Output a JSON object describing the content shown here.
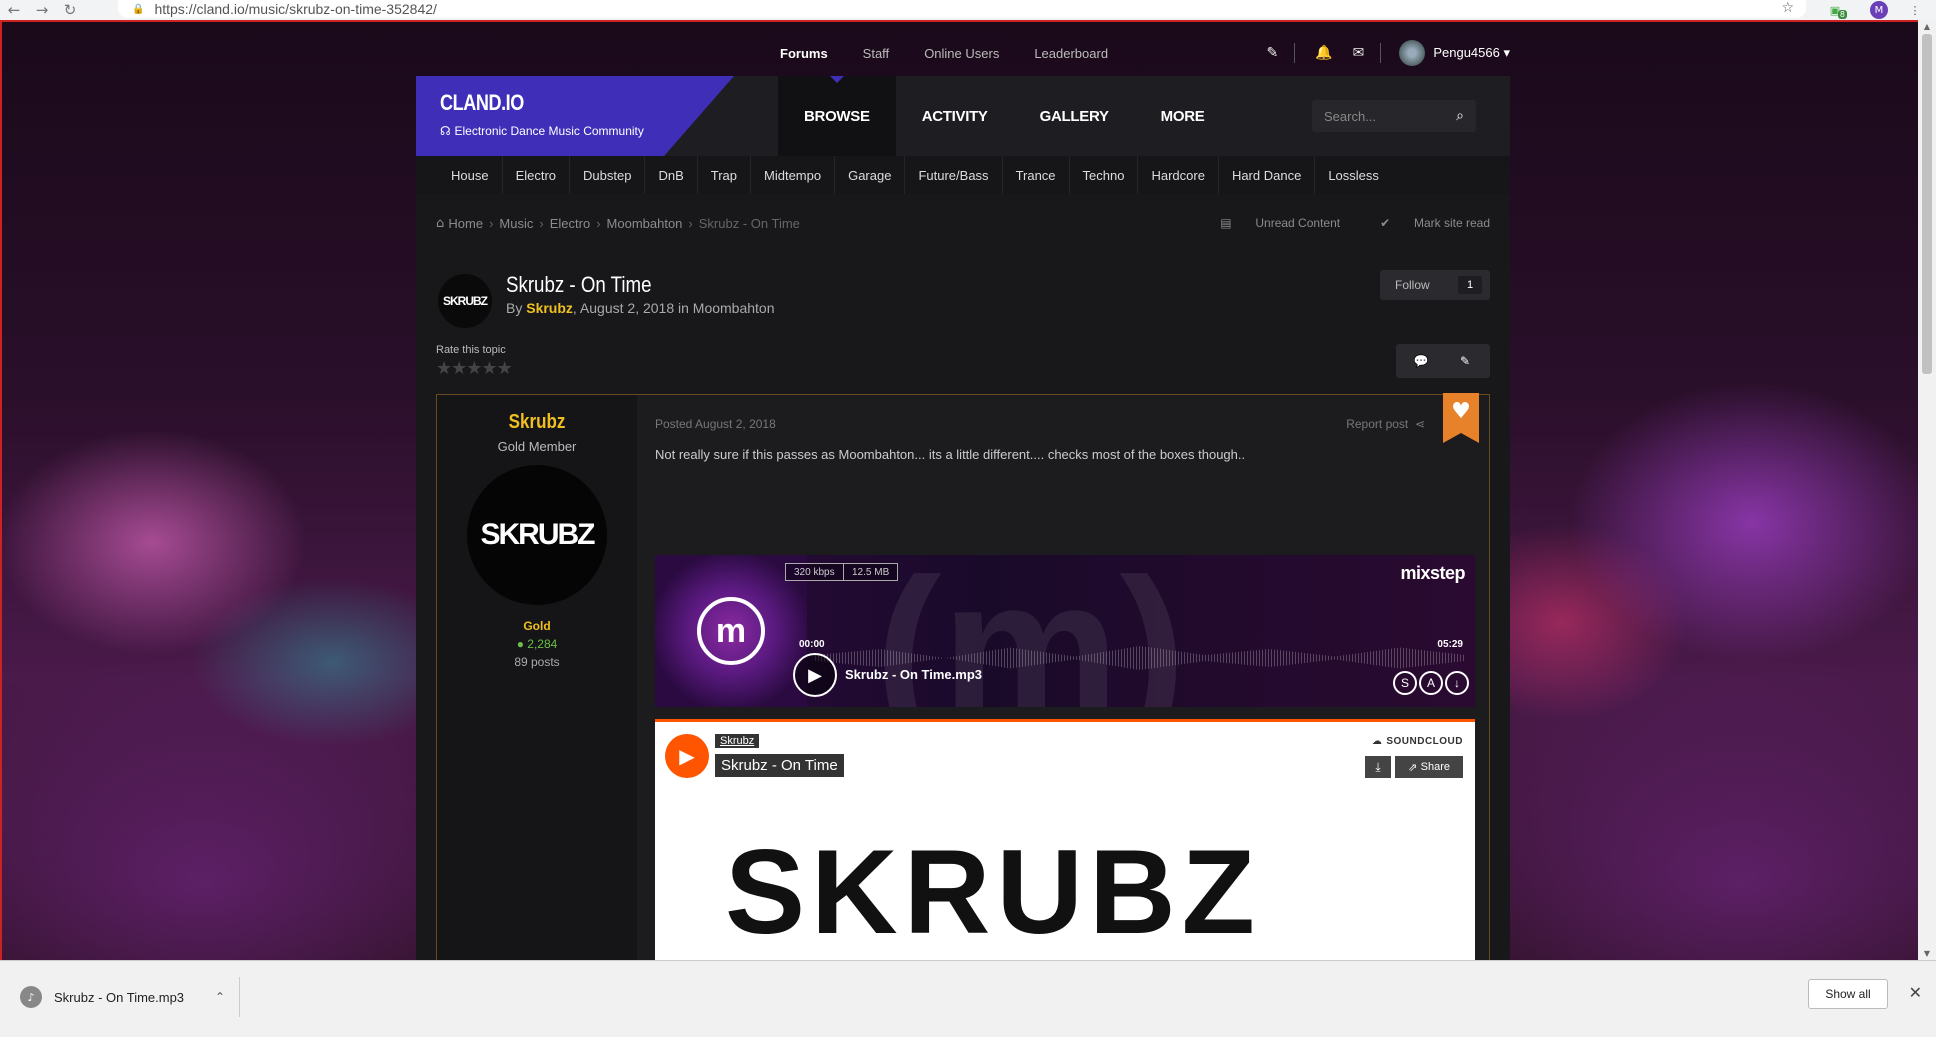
{
  "browser": {
    "url": "https://cland.io/music/skrubz-on-time-352842/",
    "ext_badge": "8",
    "profile_letter": "M"
  },
  "util_nav": {
    "items": [
      "Forums",
      "Staff",
      "Online Users",
      "Leaderboard"
    ],
    "username": "Pengu4566 ▾"
  },
  "brand": {
    "title": "CLAND.IO",
    "subtitle": "Electronic Dance Music Community"
  },
  "main_nav": [
    "BROWSE",
    "ACTIVITY",
    "GALLERY",
    "MORE"
  ],
  "search": {
    "placeholder": "Search..."
  },
  "sub_nav": [
    "House",
    "Electro",
    "Dubstep",
    "DnB",
    "Trap",
    "Midtempo",
    "Garage",
    "Future/Bass",
    "Trance",
    "Techno",
    "Hardcore",
    "Hard Dance",
    "Lossless"
  ],
  "breadcrumb": {
    "items": [
      "Home",
      "Music",
      "Electro",
      "Moombahton"
    ],
    "current": "Skrubz - On Time",
    "unread": "Unread Content",
    "mark_read": "Mark site read"
  },
  "topic": {
    "avatar_text": "SKRUBZ",
    "title": "Skrubz - On Time",
    "by": "By ",
    "author": "Skrubz",
    "meta_rest": ", August 2, 2018 in Moombahton",
    "follow_label": "Follow",
    "follow_count": "1",
    "rate_label": "Rate this topic",
    "rating_stars": 0
  },
  "post": {
    "author": "Skrubz",
    "rank": "Gold Member",
    "avatar_text": "SKRUBZ",
    "group": "Gold",
    "reputation": "● 2,284",
    "post_count": "89 posts",
    "date": "Posted August 2, 2018",
    "report": "Report post",
    "body": "Not really sure if this passes as Moombahton... its a little different.... checks most of the boxes though.."
  },
  "mixstep": {
    "bitrate": "320 kbps",
    "size": "12.5 MB",
    "brand": "mixstep",
    "time_start": "00:00",
    "time_end": "05:29",
    "track": "Skrubz - On Time.mp3",
    "ctl_1": "S",
    "ctl_2": "A",
    "ctl_3": "↓"
  },
  "soundcloud": {
    "user": "Skrubz",
    "title": "Skrubz - On Time",
    "brand": "SOUNDCLOUD",
    "share": "Share",
    "art_text": "SKRUBZ"
  },
  "download_bar": {
    "file": "Skrubz - On Time.mp3",
    "show_all": "Show all"
  },
  "colors": {
    "brand_purple": "#3f2fb8",
    "author_gold": "#f0c020",
    "heart_orange": "#e8822a",
    "soundcloud_orange": "#ff5500"
  }
}
